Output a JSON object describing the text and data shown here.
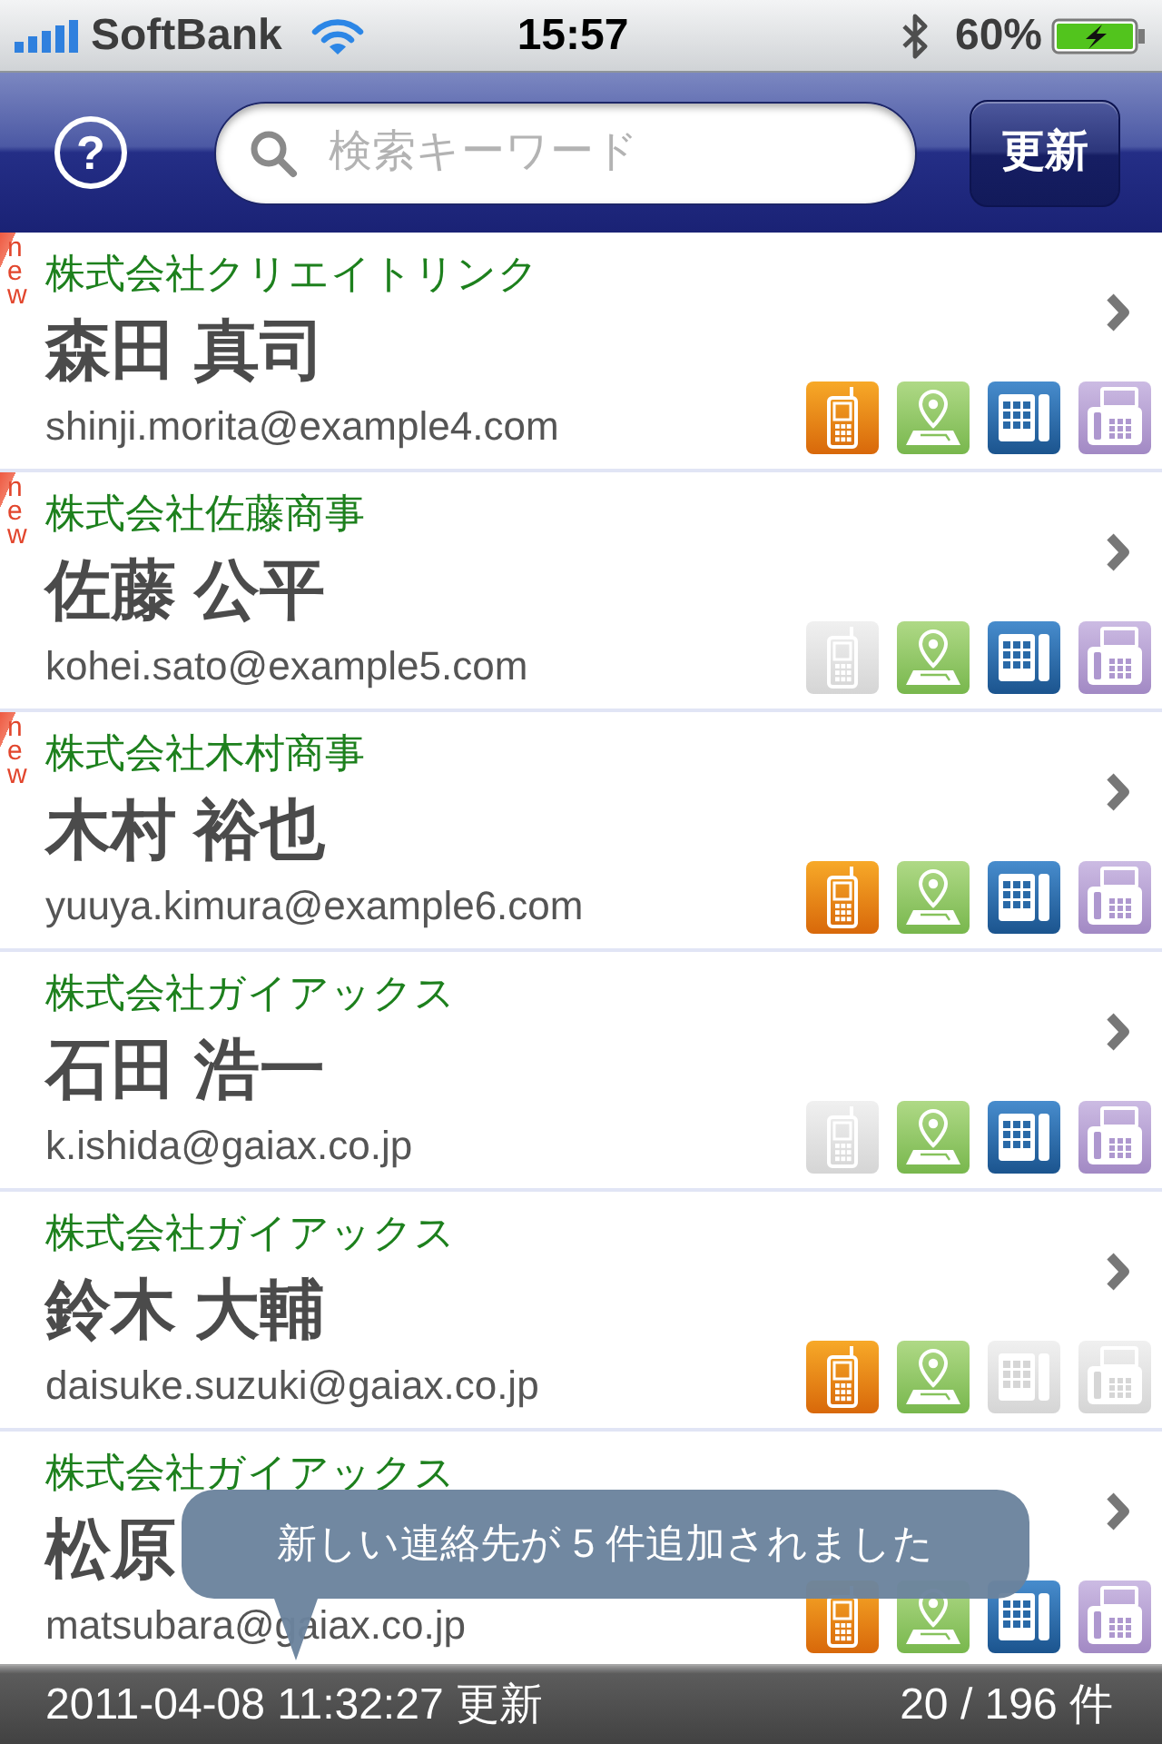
{
  "status_bar": {
    "carrier": "SoftBank",
    "time": "15:57",
    "battery": "60%"
  },
  "nav_bar": {
    "help_button": "?",
    "search": {
      "placeholder": "検索キーワード"
    },
    "refresh_button": "更新"
  },
  "contacts": [
    {
      "badge": "new",
      "company": "株式会社クリエイトリンク",
      "name": "森田 真司",
      "email": "shinji.morita@example4.com",
      "channels": [
        {
          "kind": "mobile",
          "available": true
        },
        {
          "kind": "map",
          "available": true
        },
        {
          "kind": "phone",
          "available": true
        },
        {
          "kind": "fax",
          "available": true
        }
      ]
    },
    {
      "badge": "new",
      "company": "株式会社佐藤商事",
      "name": "佐藤 公平",
      "email": "kohei.sato@example5.com",
      "channels": [
        {
          "kind": "mobile",
          "available": false
        },
        {
          "kind": "map",
          "available": true
        },
        {
          "kind": "phone",
          "available": true
        },
        {
          "kind": "fax",
          "available": true
        }
      ]
    },
    {
      "badge": "new",
      "company": "株式会社木村商事",
      "name": "木村 裕也",
      "email": "yuuya.kimura@example6.com",
      "channels": [
        {
          "kind": "mobile",
          "available": true
        },
        {
          "kind": "map",
          "available": true
        },
        {
          "kind": "phone",
          "available": true
        },
        {
          "kind": "fax",
          "available": true
        }
      ]
    },
    {
      "company": "株式会社ガイアックス",
      "name": "石田 浩一",
      "email": "k.ishida@gaiax.co.jp",
      "channels": [
        {
          "kind": "mobile",
          "available": false
        },
        {
          "kind": "map",
          "available": true
        },
        {
          "kind": "phone",
          "available": true
        },
        {
          "kind": "fax",
          "available": true
        }
      ]
    },
    {
      "company": "株式会社ガイアックス",
      "name": "鈴木 大輔",
      "email": "daisuke.suzuki@gaiax.co.jp",
      "channels": [
        {
          "kind": "mobile",
          "available": true
        },
        {
          "kind": "map",
          "available": true
        },
        {
          "kind": "phone",
          "available": false
        },
        {
          "kind": "fax",
          "available": false
        }
      ]
    },
    {
      "company": "株式会社ガイアックス",
      "name": "松原",
      "email": "matsubara@gaiax.co.jp",
      "channels": [
        {
          "kind": "mobile",
          "available": true
        },
        {
          "kind": "map",
          "available": true
        },
        {
          "kind": "phone",
          "available": true
        },
        {
          "kind": "fax",
          "available": true
        }
      ]
    }
  ],
  "toast": {
    "message": "新しい連絡先が 5 件追加されました"
  },
  "toolbar": {
    "updated": "2011-04-08 11:32:27 更新",
    "count": "20 / 196 件"
  }
}
